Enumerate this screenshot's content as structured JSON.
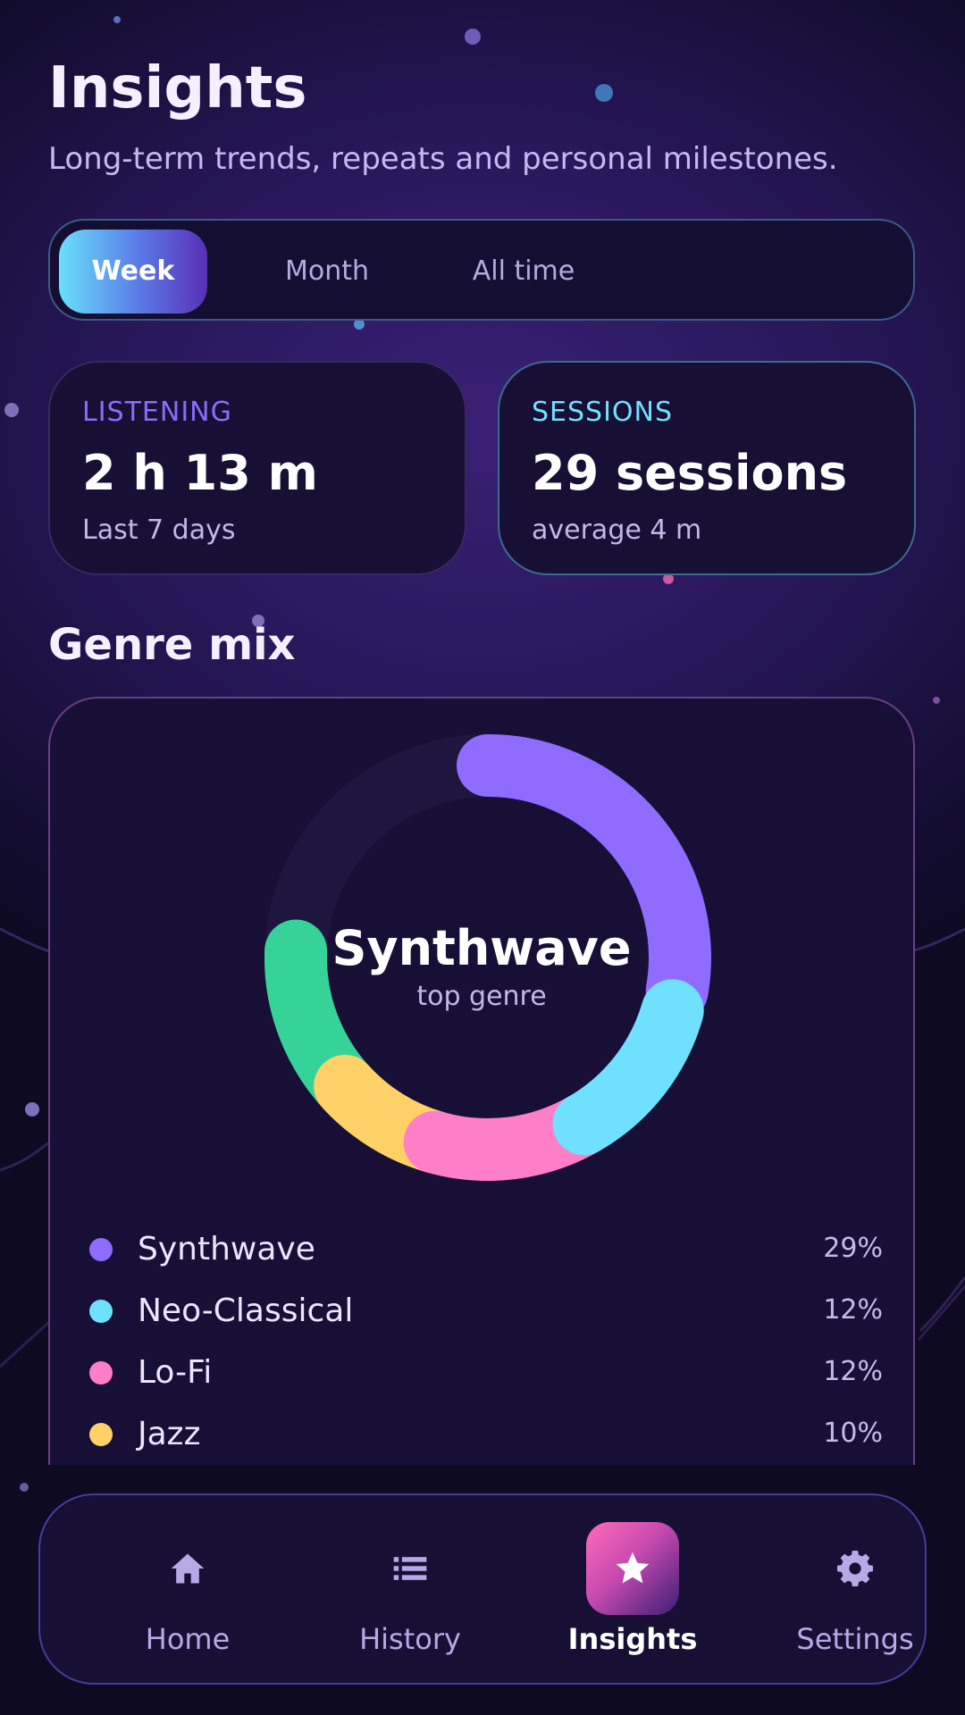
{
  "header": {
    "title": "Insights",
    "subtitle": "Long-term trends, repeats and personal milestones."
  },
  "period_tabs": [
    {
      "label": "Week",
      "active": true
    },
    {
      "label": "Month",
      "active": false
    },
    {
      "label": "All time",
      "active": false
    }
  ],
  "stats": {
    "listening": {
      "label": "LISTENING",
      "value": "2 h 13 m",
      "note": "Last 7 days",
      "color": "#8c6cff"
    },
    "sessions": {
      "label": "SESSIONS",
      "value": "29 sessions",
      "note": "average 4 m",
      "color": "#6fe1ff"
    }
  },
  "genre_section": {
    "title": "Genre mix",
    "center_title": "Synthwave",
    "center_subtitle": "top genre"
  },
  "genres": [
    {
      "name": "Synthwave",
      "percent": "29%",
      "color": "#8f6bff"
    },
    {
      "name": "Neo-Classical",
      "percent": "12%",
      "color": "#6fe1ff"
    },
    {
      "name": "Lo-Fi",
      "percent": "12%",
      "color": "#ff7ec8"
    },
    {
      "name": "Jazz",
      "percent": "10%",
      "color": "#ffd166"
    }
  ],
  "extra_segment_color": "#36d399",
  "nav": {
    "items": [
      {
        "label": "Home",
        "icon": "home-icon",
        "active": false
      },
      {
        "label": "History",
        "icon": "list-icon",
        "active": false
      },
      {
        "label": "Insights",
        "icon": "star-icon",
        "active": true
      },
      {
        "label": "Settings",
        "icon": "gear-icon",
        "active": false
      }
    ]
  }
}
